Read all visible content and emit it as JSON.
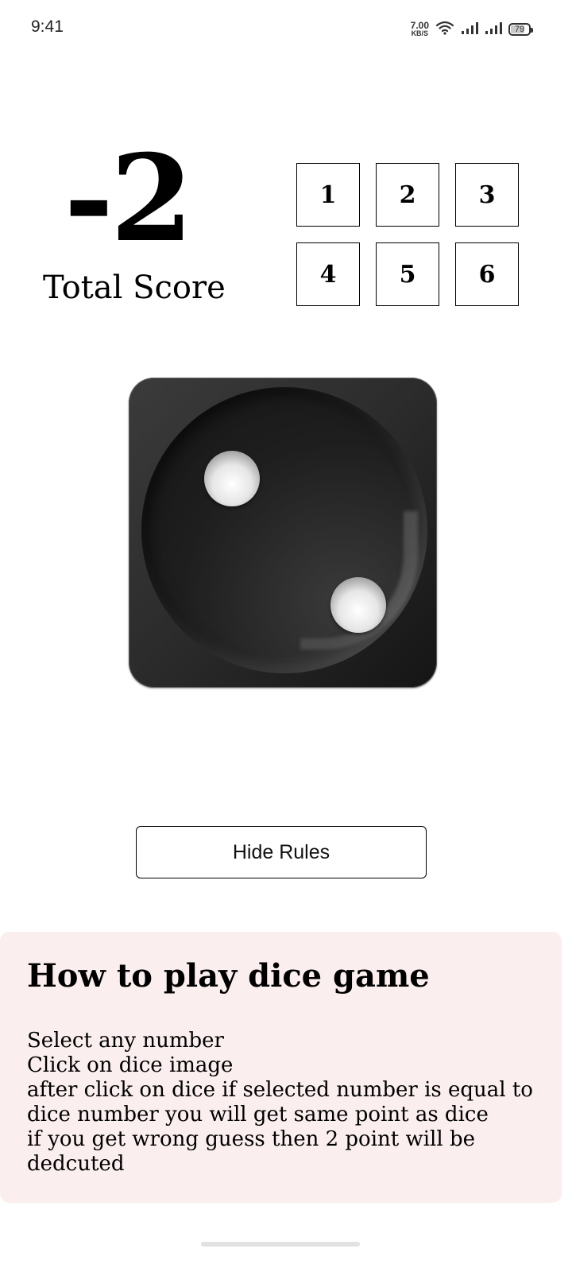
{
  "status_bar": {
    "time": "9:41",
    "net_speed_value": "7.00",
    "net_speed_unit": "KB/S",
    "battery_level": "79",
    "icons": [
      "wifi-icon",
      "signal-icon",
      "signal-icon-2",
      "battery-icon"
    ]
  },
  "score": {
    "value": "-2",
    "label": "Total Score"
  },
  "numbers": [
    "1",
    "2",
    "3",
    "4",
    "5",
    "6"
  ],
  "dice": {
    "face_value": 2,
    "color": "#2b2b2b"
  },
  "rules_button": {
    "label": "Hide Rules"
  },
  "rules": {
    "title": "How to play dice game",
    "lines": [
      "Select any number",
      "Click on dice image",
      "after click on dice if selected number is equal to",
      "dice number you will get same point as dice",
      "if you get wrong guess then 2 point will be",
      "dedcuted"
    ],
    "background": "#fbeeee"
  }
}
